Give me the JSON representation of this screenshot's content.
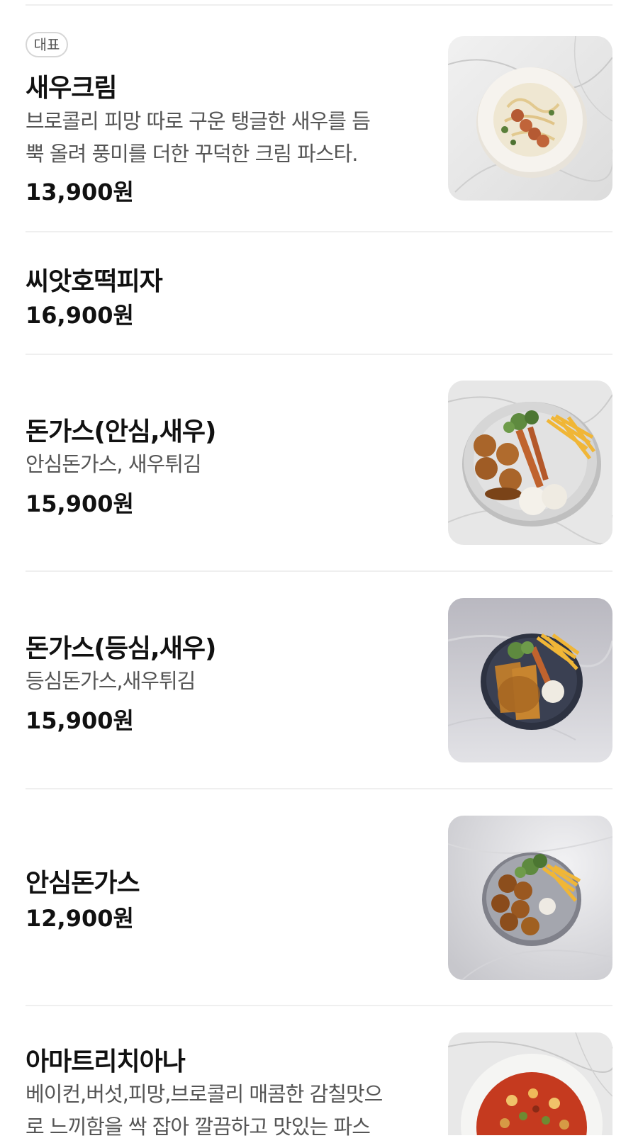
{
  "menu": {
    "items": [
      {
        "badge": "대표",
        "name": "새우크림",
        "desc_line1": "브로콜리 피망 따로 구운 탱글한 새우를 듬",
        "desc_line2": "뿍 올려 풍미를 더한 꾸덕한 크림 파스타.",
        "price": "13,900원",
        "photo": "shrimp-cream-pasta-photo"
      },
      {
        "name": "씨앗호떡피자",
        "price": "16,900원"
      },
      {
        "name": "돈가스(안심,새우)",
        "desc_line1": "안심돈가스, 새우튀김",
        "price": "15,900원",
        "photo": "tenderloin-shrimp-cutlet-photo"
      },
      {
        "name": "돈가스(등심,새우)",
        "desc_line1": "등심돈가스,새우튀김",
        "price": "15,900원",
        "photo": "loin-shrimp-cutlet-photo"
      },
      {
        "name": "안심돈가스",
        "price": "12,900원",
        "photo": "tenderloin-cutlet-photo"
      },
      {
        "name": "아마트리치아나",
        "desc_line1": "베이컨,버섯,피망,브로콜리 매콤한 감칠맛으",
        "desc_line2": "로 느끼함을 싹 잡아 깔끔하고 맛있는 파스",
        "photo": "amatriciana-pasta-photo"
      }
    ]
  }
}
